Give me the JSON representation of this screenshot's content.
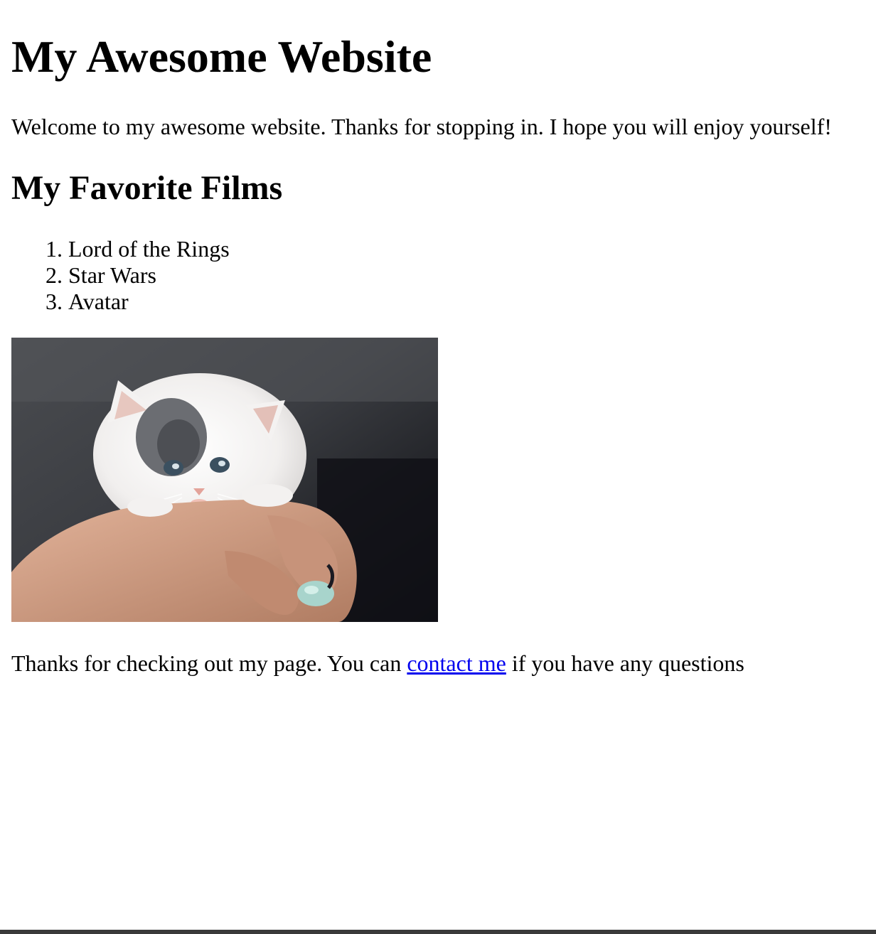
{
  "page": {
    "title": "My Awesome Website",
    "intro": "Welcome to my awesome website. Thanks for stopping in. I hope you will enjoy yourself!",
    "films_heading": "My Favorite Films",
    "films": [
      "Lord of the Rings",
      "Star Wars",
      "Avatar"
    ],
    "photo_alt": "kitten-photo",
    "outro_before": "Thanks for checking out my page. You can ",
    "outro_link": "contact me",
    "outro_after": " if you have any questions"
  },
  "colors": {
    "link": "#0000ee",
    "text": "#000000",
    "background": "#ffffff"
  }
}
